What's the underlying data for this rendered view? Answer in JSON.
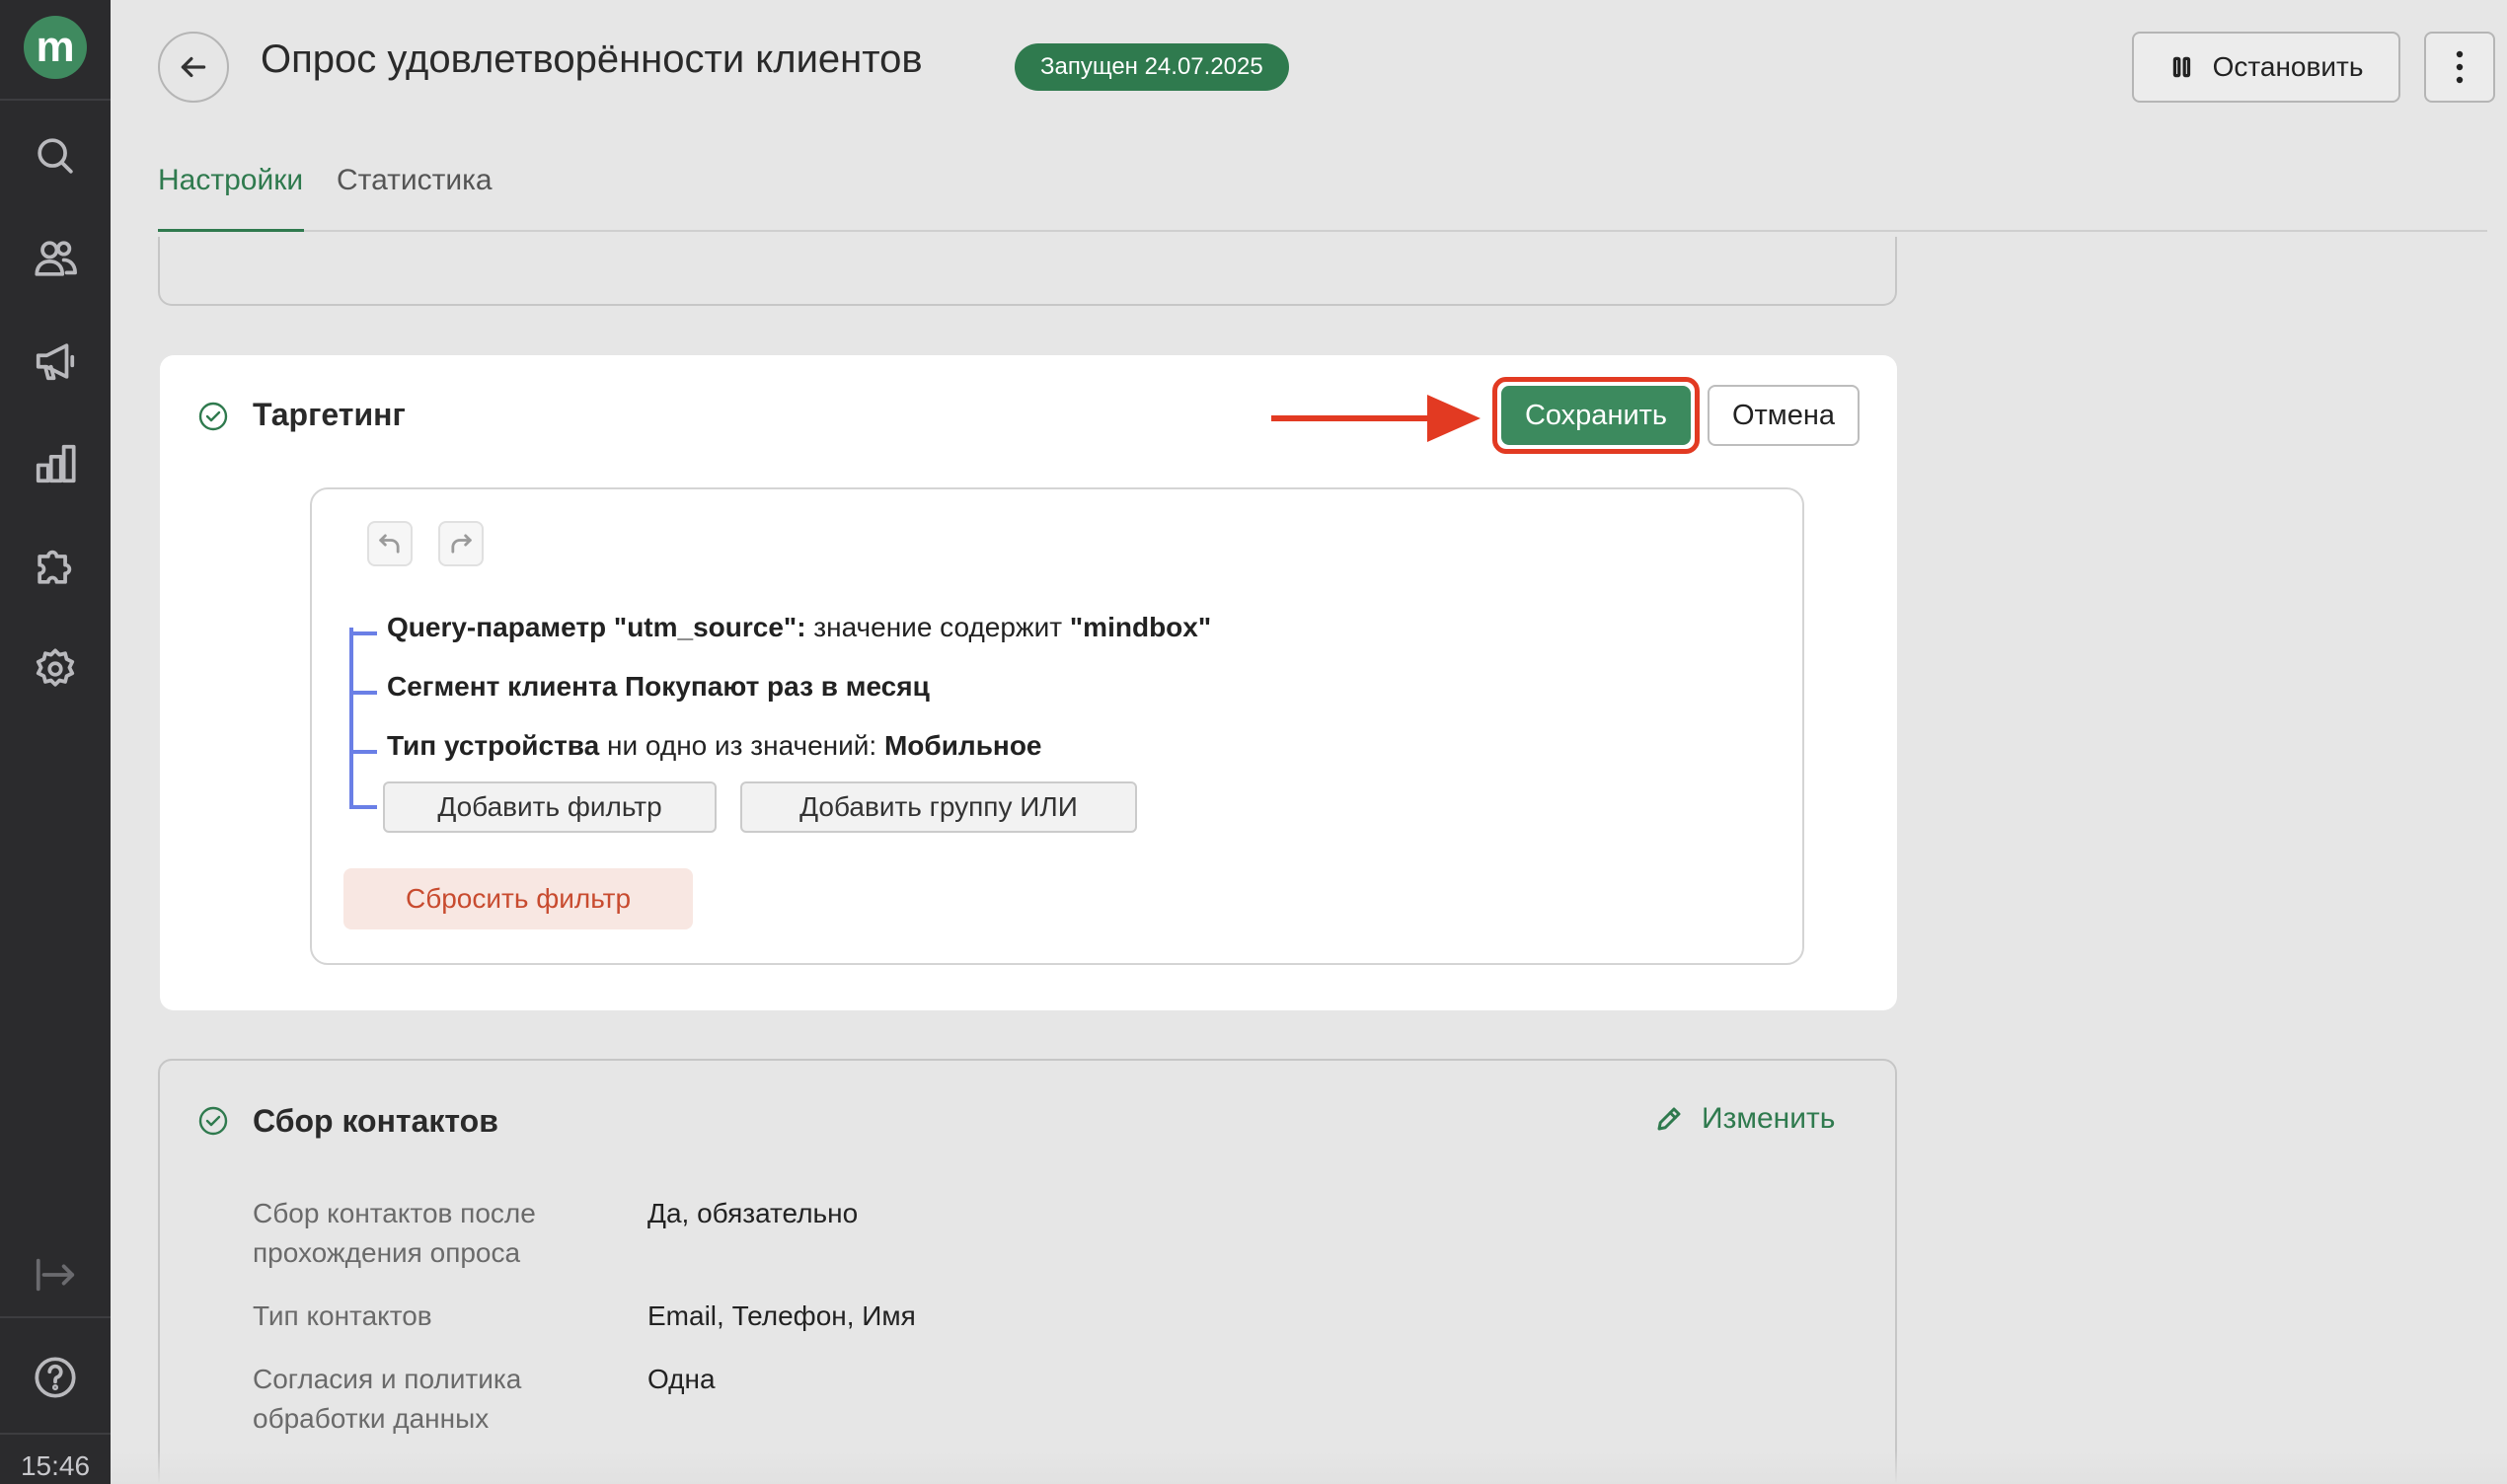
{
  "sidebar": {
    "logo_letter": "m",
    "icons": [
      "search-icon",
      "users-icon",
      "megaphone-icon",
      "chart-icon",
      "puzzle-icon",
      "gear-icon",
      "collapse-icon",
      "help-icon"
    ],
    "clock": "15:46"
  },
  "header": {
    "title": "Опрос удовлетворённости клиентов",
    "status": "Запущен 24.07.2025",
    "stop_label": "Остановить"
  },
  "tabs": [
    {
      "label": "Настройки",
      "active": true
    },
    {
      "label": "Статистика",
      "active": false
    }
  ],
  "targeting": {
    "title": "Таргетинг",
    "save_label": "Сохранить",
    "cancel_label": "Отмена",
    "conditions": [
      {
        "bold": "Query-параметр \"utm_source\":",
        "rest": " значение содержит ",
        "bold2": "\"mindbox\""
      },
      {
        "bold": "Сегмент клиента Покупают раз в месяц",
        "rest": "",
        "bold2": ""
      },
      {
        "bold": "Тип устройства",
        "rest": " ни одно из значений: ",
        "bold2": "Мобильное"
      }
    ],
    "add_filter_label": "Добавить фильтр",
    "add_group_label": "Добавить группу ИЛИ",
    "reset_label": "Сбросить фильтр"
  },
  "contacts": {
    "title": "Сбор контактов",
    "edit_label": "Изменить",
    "rows": [
      {
        "label": "Сбор контактов после прохождения опроса",
        "value": "Да, обязательно"
      },
      {
        "label": "Тип контактов",
        "value": "Email, Телефон, Имя"
      },
      {
        "label": "Согласия и политика обработки данных",
        "value": "Одна"
      }
    ]
  },
  "colors": {
    "accent": "#2f7a4e",
    "highlight": "#e23a22",
    "sidebar": "#2b2b2d"
  }
}
